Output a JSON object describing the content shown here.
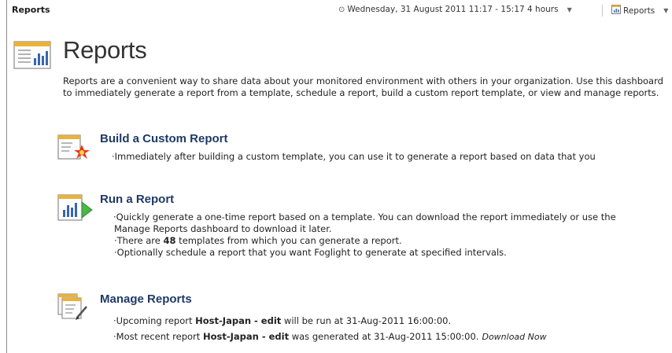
{
  "header": {
    "title": "Reports",
    "time_range": "Wednesday, 31 August 2011 11:17 - 15:17 4 hours",
    "reports_menu": "Reports"
  },
  "page": {
    "title": "Reports",
    "intro": "Reports are a convenient way to share data about your monitored environment with others in your organization. Use this dashboard to immediately generate a report from a template, schedule a report, build a custom report template, or view and manage reports."
  },
  "build": {
    "title": "Build a Custom Report",
    "bullet1": "Immediately after building a custom template, you can use it to generate a report based on data that you"
  },
  "run": {
    "title": "Run a Report",
    "bullet1": "Quickly generate a one-time report based on a template. You can download the report immediately or use the",
    "bullet1_cont": "Manage Reports dashboard to download it later.",
    "bullet2_pre": "There are ",
    "template_count": "48",
    "bullet2_post": " templates from which you can generate a report.",
    "bullet3": "Optionally schedule a report that you want Foglight to generate at specified intervals."
  },
  "manage": {
    "title": "Manage Reports",
    "upcoming_pre": "Upcoming report ",
    "upcoming_name": "Host-Japan - edit",
    "upcoming_post": " will be run at 31-Aug-2011 16:00:00.",
    "recent_pre": "Most recent report ",
    "recent_name": "Host-Japan - edit",
    "recent_post": " was generated at 31-Aug-2011 15:00:00.",
    "download_link": "Download Now"
  },
  "icons": [
    "clock-icon",
    "reports-icon",
    "report-chart-icon",
    "build-report-icon",
    "run-report-icon",
    "manage-reports-icon",
    "chevron-down-icon"
  ]
}
